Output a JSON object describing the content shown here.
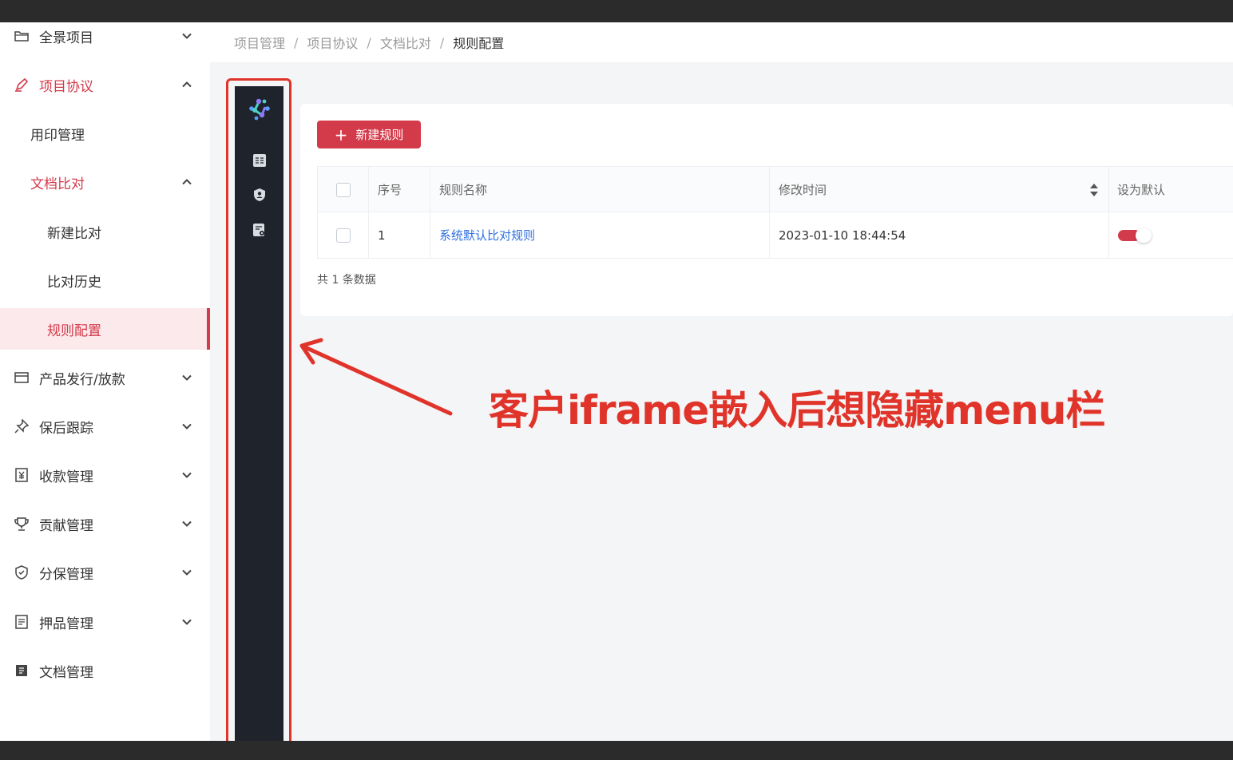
{
  "breadcrumb": [
    "项目管理",
    "项目协议",
    "文档比对",
    "规则配置"
  ],
  "sidebar": {
    "items": [
      {
        "label": "全景项目",
        "icon": "folder-icon"
      },
      {
        "label": "项目协议",
        "icon": "pen-icon"
      },
      {
        "label": "用印管理"
      },
      {
        "label": "文档比对"
      },
      {
        "label": "新建比对"
      },
      {
        "label": "比对历史"
      },
      {
        "label": "规则配置"
      },
      {
        "label": "产品发行/放款",
        "icon": "card-icon"
      },
      {
        "label": "保后跟踪",
        "icon": "pin-icon"
      },
      {
        "label": "收款管理",
        "icon": "yen-icon"
      },
      {
        "label": "贡献管理",
        "icon": "trophy-icon"
      },
      {
        "label": "分保管理",
        "icon": "shield-check-icon"
      },
      {
        "label": "押品管理",
        "icon": "list-doc-icon"
      },
      {
        "label": "文档管理",
        "icon": "document-icon"
      }
    ]
  },
  "toolbar": {
    "new_rule_label": "新建规则"
  },
  "table": {
    "headers": {
      "index": "序号",
      "name": "规则名称",
      "modified": "修改时间",
      "default": "设为默认"
    },
    "rows": [
      {
        "index": "1",
        "name": "系统默认比对规则",
        "modified": "2023-01-10 18:44:54",
        "is_default": true
      }
    ]
  },
  "total_text": "共 1 条数据",
  "annotation_text": "客户iframe嵌入后想隐藏menu栏",
  "colors": {
    "accent": "#d33a4a",
    "annotation": "#e0342a",
    "dark_menu": "#1f232b",
    "link": "#2f6fe0"
  }
}
